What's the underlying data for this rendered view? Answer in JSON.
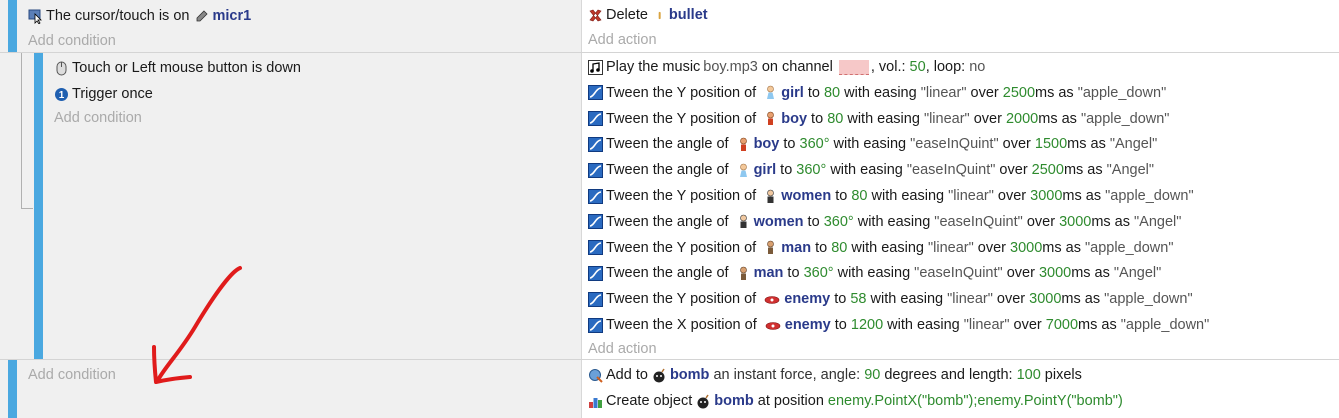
{
  "event1": {
    "condition": {
      "prefix": "The cursor/touch is on",
      "object": "micr1"
    },
    "add_condition": "Add condition",
    "action": {
      "verb": "Delete",
      "object": "bullet"
    },
    "add_action": "Add action"
  },
  "event2": {
    "conditions": [
      {
        "text": "Touch or Left mouse button is down"
      },
      {
        "text": "Trigger once"
      }
    ],
    "add_condition": "Add condition",
    "actions": [
      {
        "pre": "Play the music ",
        "file": "boy.mp3",
        "mid": " on channel ",
        "post1": ", vol.: ",
        "vol": "50",
        "post2": ", loop: ",
        "loop": "no"
      },
      {
        "pre": "Tween the Y position of ",
        "obj": "girl",
        "a": " to ",
        "v1": "80",
        "b": " with easing ",
        "ease": "\"linear\"",
        "c": " over ",
        "v2": "2500",
        "d": "ms as ",
        "name": "\"apple_down\""
      },
      {
        "pre": "Tween the Y position of ",
        "obj": "boy",
        "a": " to ",
        "v1": "80",
        "b": " with easing ",
        "ease": "\"linear\"",
        "c": " over ",
        "v2": "2000",
        "d": "ms as ",
        "name": "\"apple_down\""
      },
      {
        "pre": "Tween the angle of ",
        "obj": "boy",
        "a": " to ",
        "v1": "360°",
        "b": " with easing ",
        "ease": "\"easeInQuint\"",
        "c": " over ",
        "v2": "1500",
        "d": "ms as ",
        "name": "\"Angel\""
      },
      {
        "pre": "Tween the angle of ",
        "obj": "girl",
        "a": " to ",
        "v1": "360°",
        "b": " with easing ",
        "ease": "\"easeInQuint\"",
        "c": " over ",
        "v2": "2500",
        "d": "ms as ",
        "name": "\"Angel\""
      },
      {
        "pre": "Tween the Y position of ",
        "obj": "women",
        "a": " to ",
        "v1": "80",
        "b": " with easing ",
        "ease": "\"linear\"",
        "c": " over ",
        "v2": "3000",
        "d": "ms as ",
        "name": "\"apple_down\""
      },
      {
        "pre": "Tween the angle of ",
        "obj": "women",
        "a": " to ",
        "v1": "360°",
        "b": " with easing ",
        "ease": "\"easeInQuint\"",
        "c": " over ",
        "v2": "3000",
        "d": "ms as ",
        "name": "\"Angel\""
      },
      {
        "pre": "Tween the Y position of ",
        "obj": "man",
        "a": " to ",
        "v1": "80",
        "b": " with easing ",
        "ease": "\"linear\"",
        "c": " over ",
        "v2": "3000",
        "d": "ms as ",
        "name": "\"apple_down\""
      },
      {
        "pre": "Tween the angle of ",
        "obj": "man",
        "a": " to ",
        "v1": "360°",
        "b": " with easing ",
        "ease": "\"easeInQuint\"",
        "c": " over ",
        "v2": "3000",
        "d": "ms as ",
        "name": "\"Angel\""
      },
      {
        "pre": "Tween the Y position of ",
        "obj": "enemy",
        "a": " to ",
        "v1": "58",
        "b": " with easing ",
        "ease": "\"linear\"",
        "c": " over ",
        "v2": "3000",
        "d": "ms as ",
        "name": "\"apple_down\""
      },
      {
        "pre": "Tween the X position of ",
        "obj": "enemy",
        "a": " to ",
        "v1": "1200",
        "b": " with easing ",
        "ease": "\"linear\"",
        "c": " over ",
        "v2": "7000",
        "d": "ms as ",
        "name": "\"apple_down\""
      }
    ],
    "add_action": "Add action"
  },
  "event3": {
    "add_condition": "Add condition",
    "action1": {
      "pre": "Add to ",
      "obj": "bomb",
      "mid": " an instant force, angle: ",
      "angle": "90",
      "mid2": " degrees and length: ",
      "len": "100",
      "post": " pixels"
    },
    "action2": {
      "pre": "Create object ",
      "obj": "bomb",
      "mid": " at position ",
      "pos": "enemy.PointX(\"bomb\");enemy.PointY(\"bomb\")"
    }
  },
  "colors": {
    "bar": "#4aa8e0",
    "object": "#2a3a8a",
    "number": "#2e8b2e",
    "annotation_arrow": "#e01b1b"
  },
  "annotation": {
    "icon": "red-hand-drawn-arrow"
  }
}
